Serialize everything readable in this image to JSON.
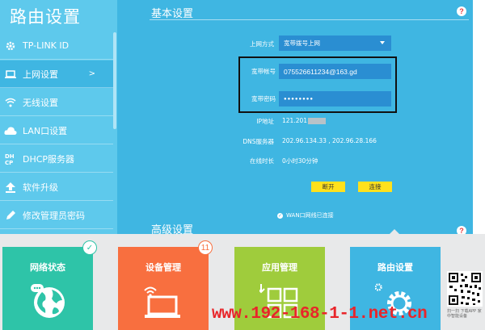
{
  "sidebar": {
    "title": "路由设置",
    "items": [
      {
        "label": "TP-LINK ID",
        "icon": "gear-icon"
      },
      {
        "label": "上网设置",
        "icon": "laptop-icon",
        "arrow": ">"
      },
      {
        "label": "无线设置",
        "icon": "wifi-icon"
      },
      {
        "label": "LAN口设置",
        "icon": "cloud-icon"
      },
      {
        "label": "DHCP服务器",
        "icon": "dhcp-icon",
        "icon_text": "DH\nCP"
      },
      {
        "label": "软件升级",
        "icon": "upload-icon"
      },
      {
        "label": "修改管理员密码",
        "icon": "pencil-icon"
      }
    ]
  },
  "basic": {
    "title": "基本设置",
    "help": "?",
    "conn_label": "上网方式",
    "conn_value": "宽带拨号上网",
    "account_label": "宽带帐号",
    "account_value": "075526611234@163.gd",
    "password_label": "宽带密码",
    "password_value": "●●●●●●●●",
    "ip_label": "IP地址",
    "ip_value": "121.201",
    "dns_label": "DNS服务器",
    "dns_value": "202.96.134.33 , 202.96.28.166",
    "online_label": "在线时长",
    "online_value": "0小时30分钟",
    "disconnect_btn": "断开",
    "connect_btn": "连接",
    "wan_status": "WAN口网线已连接"
  },
  "advanced": {
    "title": "高级设置",
    "help": "?"
  },
  "tiles": [
    {
      "label": "网络状态",
      "color": "#2ec4a8",
      "icon": "globe-icon",
      "badge": "✓"
    },
    {
      "label": "设备管理",
      "color": "#f86f3f",
      "icon": "laptop-wifi-icon",
      "badge": "11"
    },
    {
      "label": "应用管理",
      "color": "#9fcc3c",
      "icon": "apps-grid-icon"
    },
    {
      "label": "路由设置",
      "color": "#3fb6e2",
      "icon": "settings-gear-icon"
    }
  ],
  "qr_caption": "扫一扫 下载APP 家中智能设备",
  "watermark": "www.192-168-1-1.net.cn",
  "colors": {
    "sidebar": "#5ec9ec",
    "main": "#3fb6e2",
    "field": "#2a8ed2",
    "button": "#ffe11c",
    "help": "#e8383d"
  }
}
